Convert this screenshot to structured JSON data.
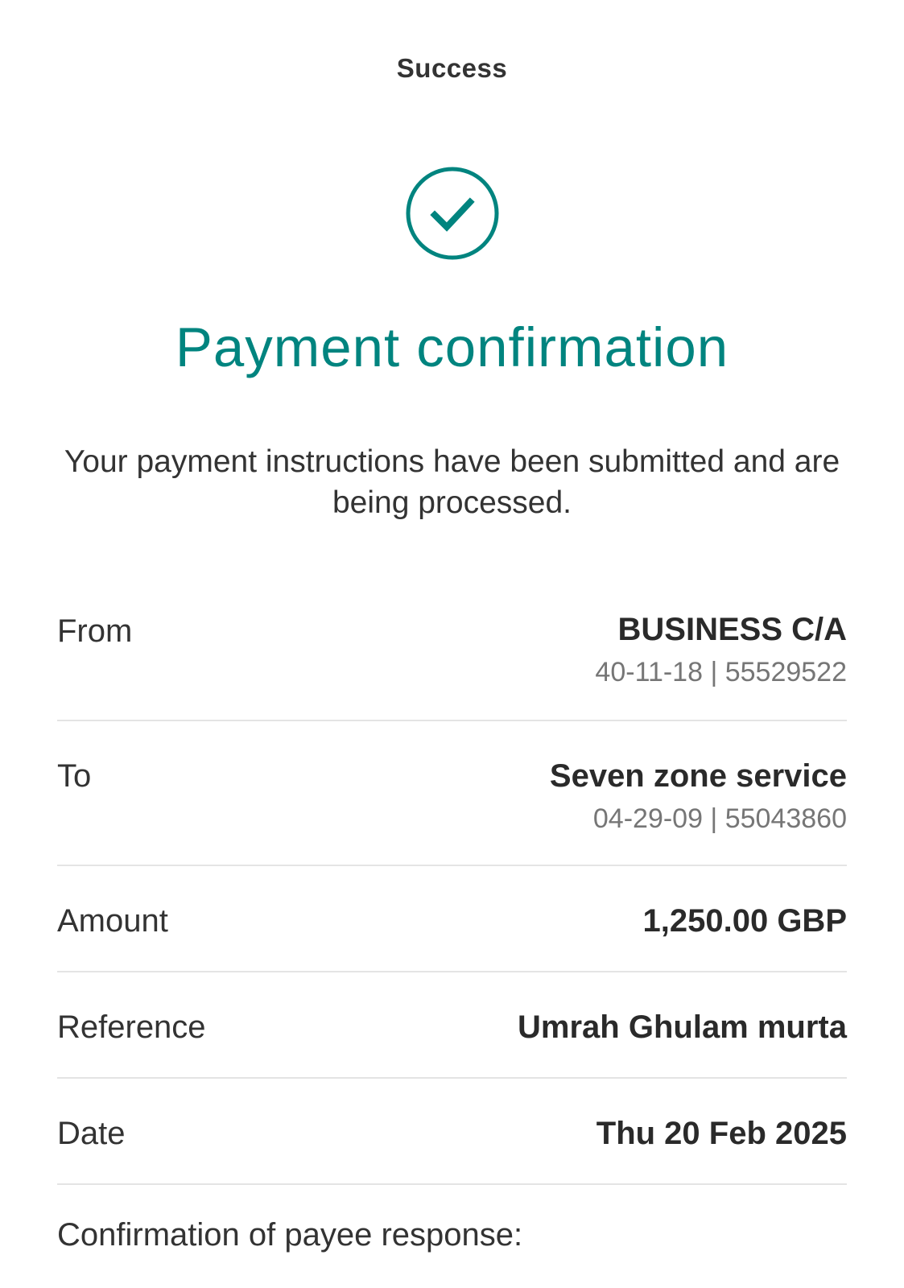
{
  "header": {
    "title": "Success"
  },
  "status_icon": "check-circle-icon",
  "accent_color": "#00847f",
  "main": {
    "title": "Payment confirmation",
    "message": "Your payment instructions have been submitted and are being processed."
  },
  "details": {
    "from": {
      "label": "From",
      "value": "BUSINESS C/A",
      "sub": "40-11-18 | 55529522"
    },
    "to": {
      "label": "To",
      "value": "Seven zone service",
      "sub": "04-29-09 | 55043860"
    },
    "amount": {
      "label": "Amount",
      "value": "1,250.00 GBP"
    },
    "reference": {
      "label": "Reference",
      "value": "Umrah Ghulam murta"
    },
    "date": {
      "label": "Date",
      "value": "Thu 20 Feb 2025"
    }
  },
  "confirmation_of_payee": {
    "heading": "Confirmation of payee response:"
  }
}
